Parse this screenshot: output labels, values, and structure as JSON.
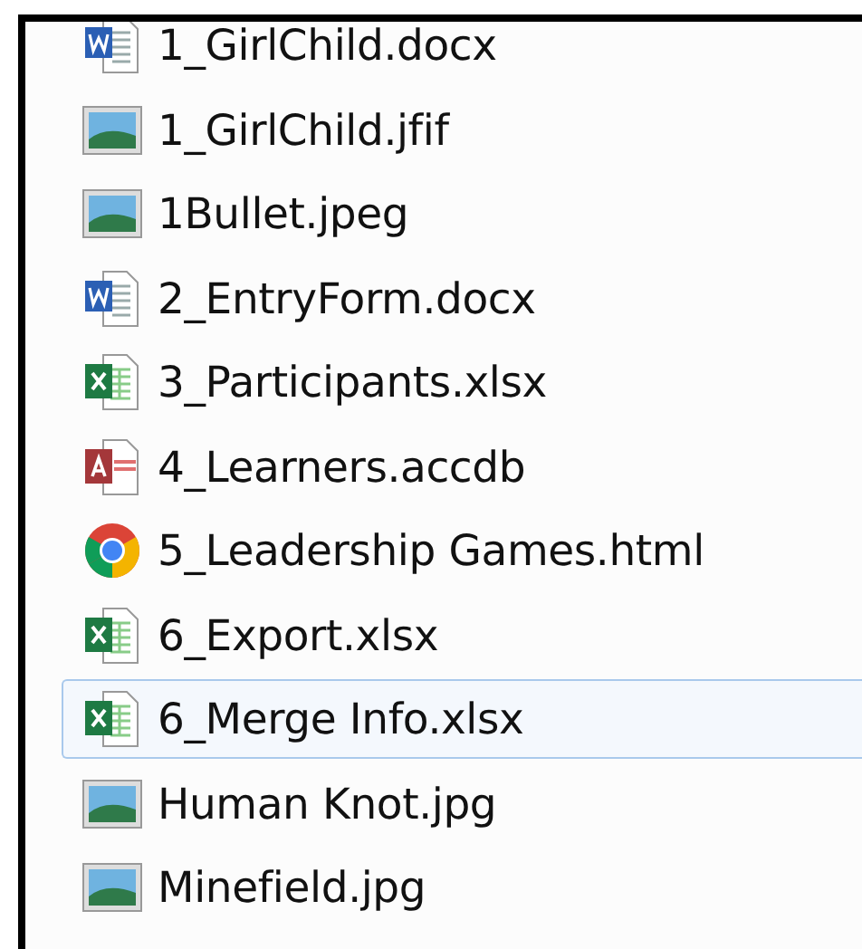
{
  "files": [
    {
      "name": "1_GirlChild.docx",
      "kind": "word",
      "selected": false
    },
    {
      "name": "1_GirlChild.jfif",
      "kind": "image",
      "selected": false
    },
    {
      "name": "1Bullet.jpeg",
      "kind": "image",
      "selected": false
    },
    {
      "name": "2_EntryForm.docx",
      "kind": "word",
      "selected": false
    },
    {
      "name": "3_Participants.xlsx",
      "kind": "excel",
      "selected": false
    },
    {
      "name": "4_Learners.accdb",
      "kind": "access",
      "selected": false
    },
    {
      "name": "5_Leadership Games.html",
      "kind": "chrome",
      "selected": false
    },
    {
      "name": "6_Export.xlsx",
      "kind": "excel",
      "selected": false
    },
    {
      "name": "6_Merge Info.xlsx",
      "kind": "excel",
      "selected": true
    },
    {
      "name": "Human Knot.jpg",
      "kind": "image",
      "selected": false
    },
    {
      "name": "Minefield.jpg",
      "kind": "image",
      "selected": false
    }
  ]
}
